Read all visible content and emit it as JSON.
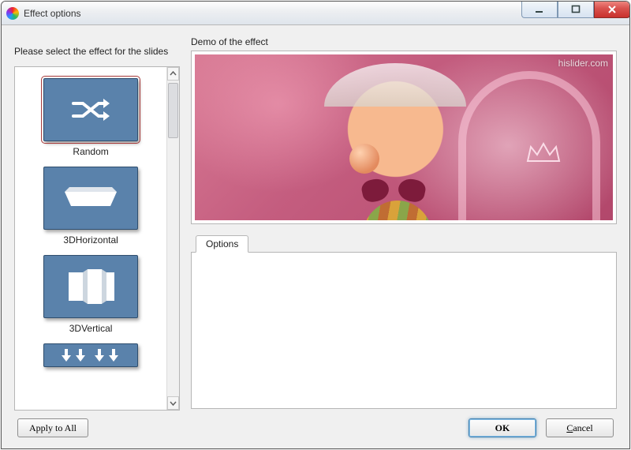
{
  "window": {
    "title": "Effect options"
  },
  "left": {
    "instruction": "Please select the effect for the slides",
    "items": [
      {
        "key": "random",
        "label": "Random",
        "selected": true
      },
      {
        "key": "3dhorizontal",
        "label": "3DHorizontal",
        "selected": false
      },
      {
        "key": "3dvertical",
        "label": "3DVertical",
        "selected": false
      },
      {
        "key": "partial",
        "label": "",
        "selected": false
      }
    ]
  },
  "right": {
    "demo_label": "Demo of the effect",
    "watermark": "hislider.com",
    "options_tab": "Options"
  },
  "footer": {
    "apply_all": "Apply to All",
    "ok": "OK",
    "cancel_prefix": "C",
    "cancel_rest": "ancel"
  }
}
